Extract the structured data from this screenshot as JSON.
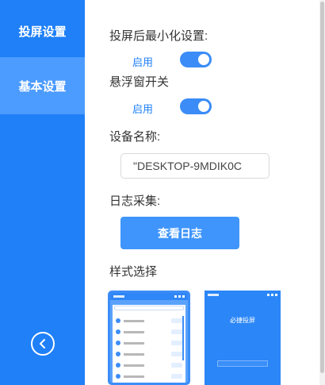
{
  "sidebar": {
    "items": [
      {
        "label": "投屏设置"
      },
      {
        "label": "基本设置"
      }
    ],
    "collapse_icon": "chevron-left-circle-icon"
  },
  "settings": {
    "minimize_label": "投屏后最小化设置:",
    "minimize_toggle_text": "启用",
    "minimize_enabled": true,
    "float_label": "悬浮窗开关",
    "float_toggle_text": "启用",
    "float_enabled": true,
    "device_name_label": "设备名称:",
    "device_name_value": "\"DESKTOP-9MDIK0C",
    "log_label": "日志采集:",
    "log_button": "查看日志",
    "style_label": "样式选择",
    "style_preview_2_title": "必捷投屏"
  },
  "colors": {
    "sidebar": "#1f80f8",
    "sidebar_active": "#4c9bff",
    "accent": "#3f95fb"
  }
}
